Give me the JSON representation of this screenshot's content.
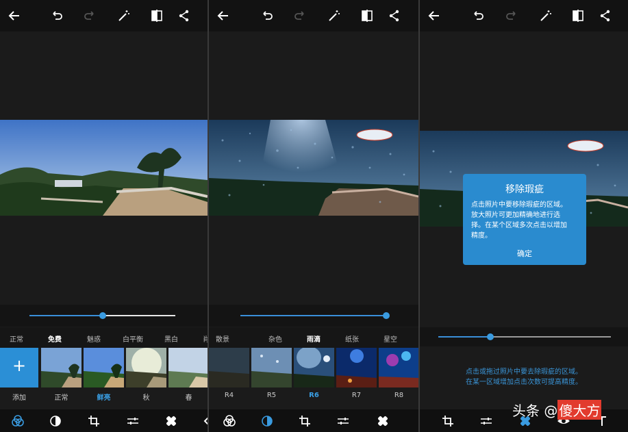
{
  "colors": {
    "accent": "#3a9be0",
    "dialog_bg": "#2a8bcf",
    "panel_bg": "#1b1b1b"
  },
  "toolbar_icons": [
    "back-arrow-icon",
    "undo-icon",
    "redo-icon",
    "magic-wand-icon",
    "compare-icon",
    "share-icon"
  ],
  "panel1": {
    "slider_value": 0.5,
    "categories": [
      "正常",
      "免费",
      "魅惑",
      "白平衡",
      "黑白",
      "肖"
    ],
    "selected_category": "免费",
    "add_label": "添加",
    "add_symbol": "+",
    "thumbs": [
      "正常",
      "鲜亮",
      "秋",
      "春"
    ],
    "selected_thumb": "鲜亮"
  },
  "panel2": {
    "slider_value": 1.0,
    "categories": [
      "散景",
      "杂色",
      "雨滴",
      "纸张",
      "星空"
    ],
    "selected_category": "雨滴",
    "thumbs": [
      "R4",
      "R5",
      "R6",
      "R7",
      "R8"
    ],
    "selected_thumb": "R6"
  },
  "panel3": {
    "slider_value": 0.3,
    "dialog": {
      "title": "移除瑕疵",
      "body_lines": [
        "点击照片中要移除瑕疵的区域。",
        "放大照片可更加精确地进行选",
        "择。在某个区域多次点击以增加",
        "精度。"
      ],
      "ok": "确定"
    },
    "hint_lines": [
      "点击或拖过照片中要去除瑕疵的区域。",
      "在某一区域增加点击次数可提高精度。"
    ]
  },
  "bottom_icons": [
    "looks-icon",
    "overlay-icon",
    "crop-icon",
    "adjust-icon",
    "heal-icon",
    "eye-icon",
    "text-icon"
  ],
  "watermark": {
    "prefix": "头条 @",
    "highlight": "傻大方"
  }
}
